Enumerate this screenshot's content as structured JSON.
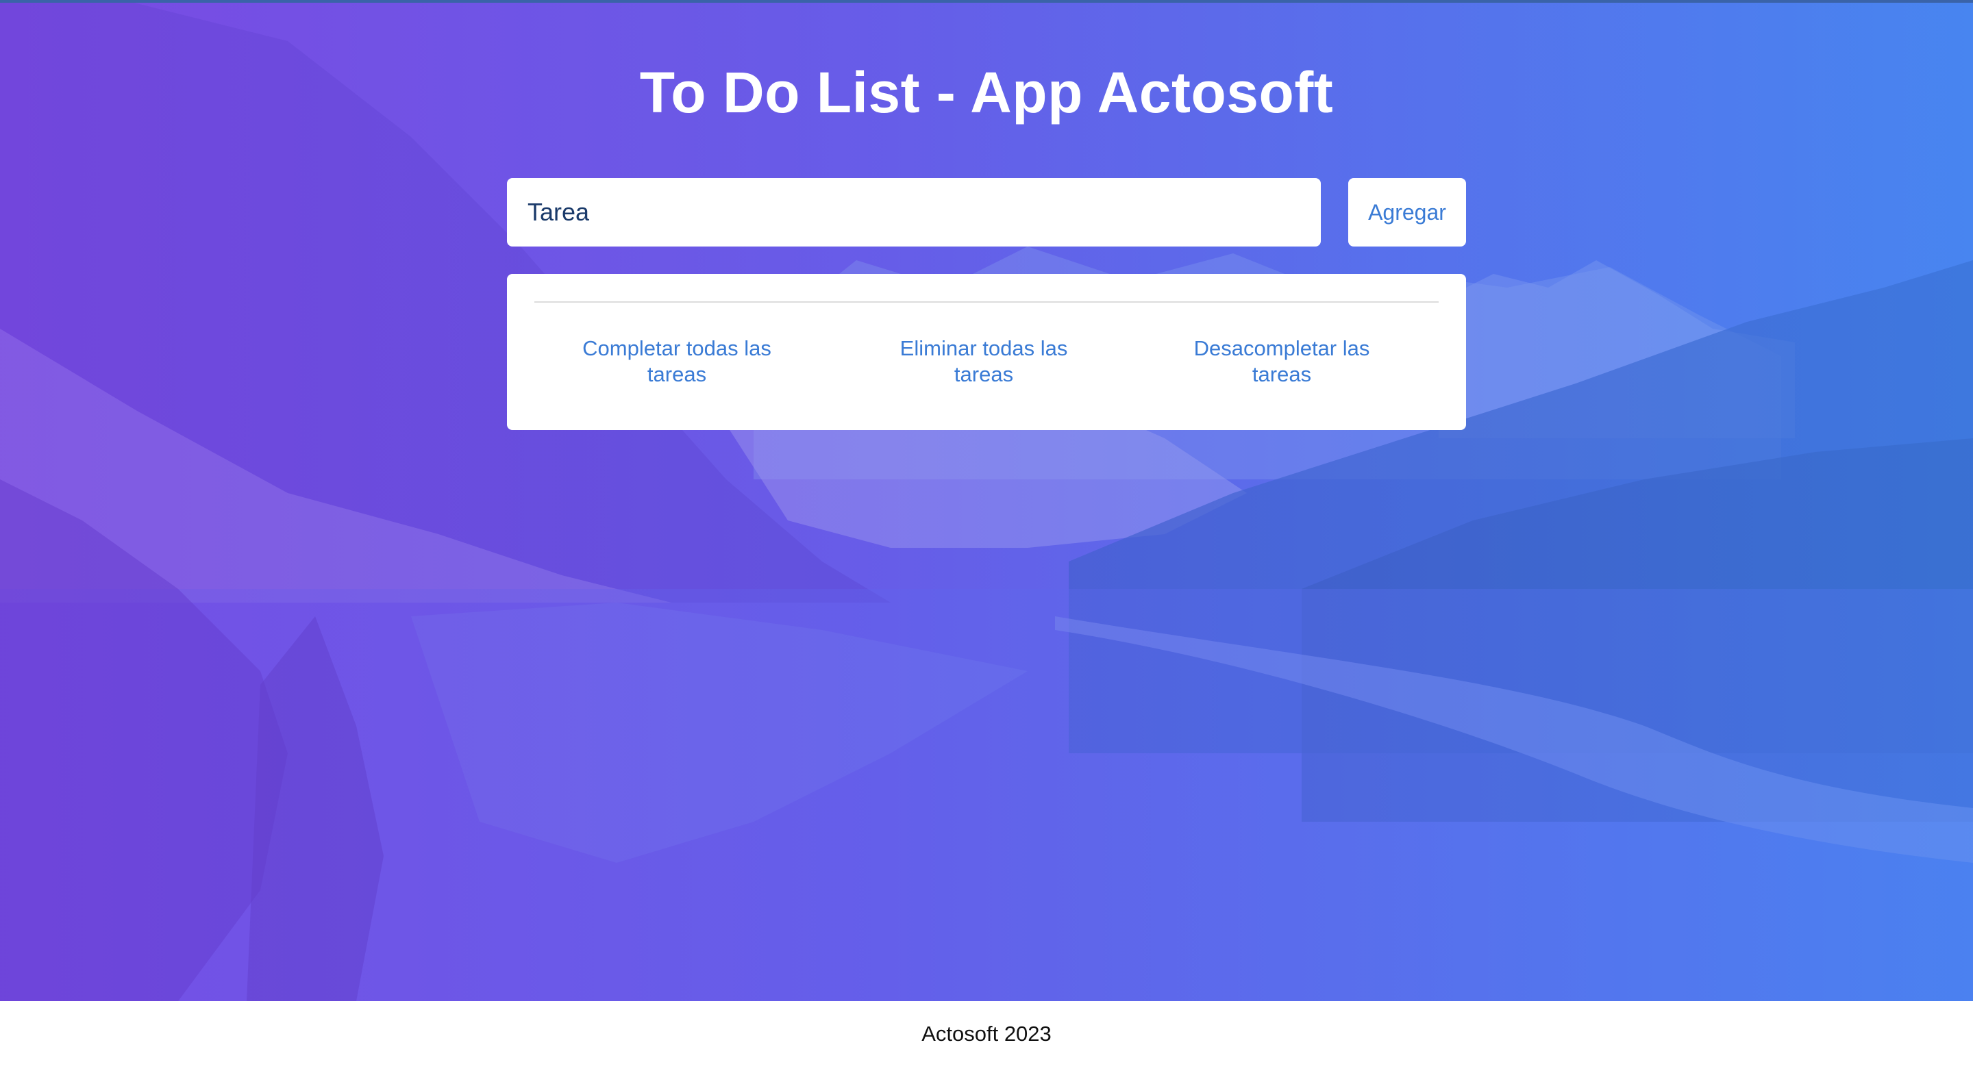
{
  "app": {
    "title": "To Do List - App Actosoft"
  },
  "form": {
    "input_placeholder": "Tarea",
    "add_label": "Agregar"
  },
  "actions": {
    "complete_all": "Completar todas las tareas",
    "delete_all": "Eliminar todas las tareas",
    "uncomplete_all": "Desacompletar las tareas"
  },
  "footer": {
    "text": "Actosoft 2023"
  },
  "colors": {
    "gradient_start": "#7a4fe0",
    "gradient_end": "#4a86ef",
    "accent": "#3a7bd5"
  }
}
